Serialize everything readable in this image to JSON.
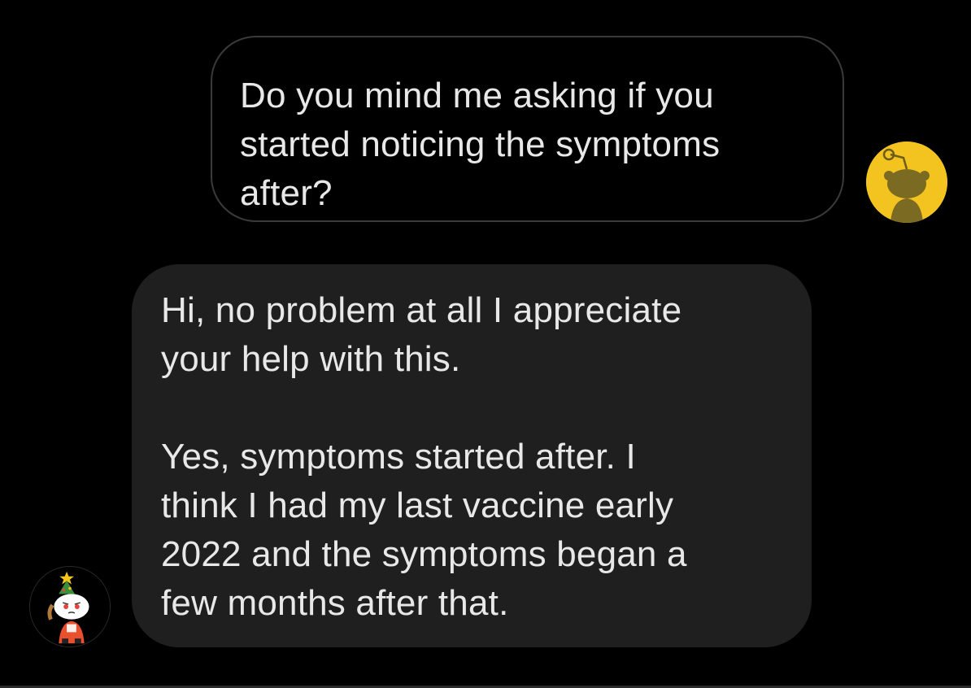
{
  "conversation": {
    "messages": [
      {
        "sender": "self",
        "text": "Do you mind me asking if you\nstarted noticing the symptoms\nafter?"
      },
      {
        "sender": "other",
        "text": "Hi, no problem at all I appreciate\nyour help with this.\n\nYes, symptoms started after. I\nthink I had my last vaccine early\n2022 and the symptoms began a\nfew months after that."
      }
    ]
  },
  "avatars": {
    "self": {
      "icon": "snoo-silhouette-avatar-icon",
      "color": "#f3c320"
    },
    "other": {
      "icon": "snoo-christmas-tree-hat-avatar-icon",
      "color": "#ffffff"
    }
  },
  "colors": {
    "background": "#000000",
    "outgoing_border": "#3a3a3a",
    "incoming_bubble": "#1f1f1f",
    "text": "#e8e8e8"
  }
}
